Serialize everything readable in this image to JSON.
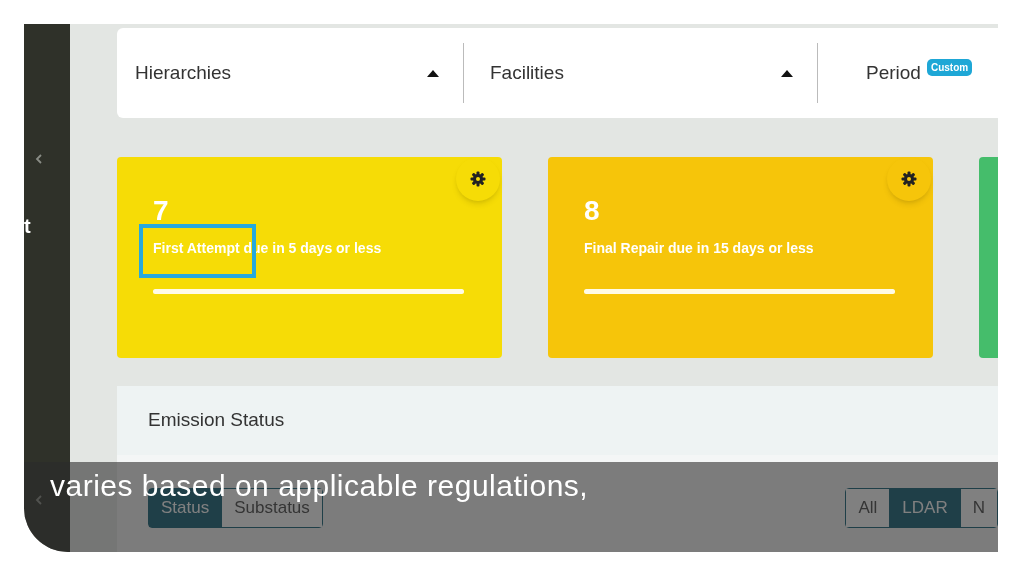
{
  "sidebar": {
    "text_fragment": "t"
  },
  "filters": [
    {
      "kind": "dropdown",
      "label": "Hierarchies"
    },
    {
      "kind": "dropdown",
      "label": "Facilities"
    },
    {
      "kind": "period",
      "label": "Period",
      "badge": "Custom"
    }
  ],
  "cards": [
    {
      "kind": "metric",
      "value": "7",
      "label": "First Attempt due in 5 days or less",
      "color": "#f6dc06",
      "level": 1,
      "highlighted": true
    },
    {
      "kind": "metric",
      "value": "8",
      "label": "Final Repair due in 15 days or less",
      "color": "#f6c50a",
      "level": 1,
      "highlighted": false
    },
    {
      "kind": "partial",
      "color": "#45bd6b"
    }
  ],
  "emission_panel": {
    "title": "Emission Status",
    "view_tabs": [
      {
        "label": "Status",
        "selected": true
      },
      {
        "label": "Substatus",
        "selected": false
      }
    ],
    "program_tabs": [
      {
        "label": "All",
        "selected": false
      },
      {
        "label": "LDAR",
        "selected": true
      },
      {
        "label": "N",
        "selected": false
      }
    ]
  },
  "caption": "varies based on applicable regulations,"
}
